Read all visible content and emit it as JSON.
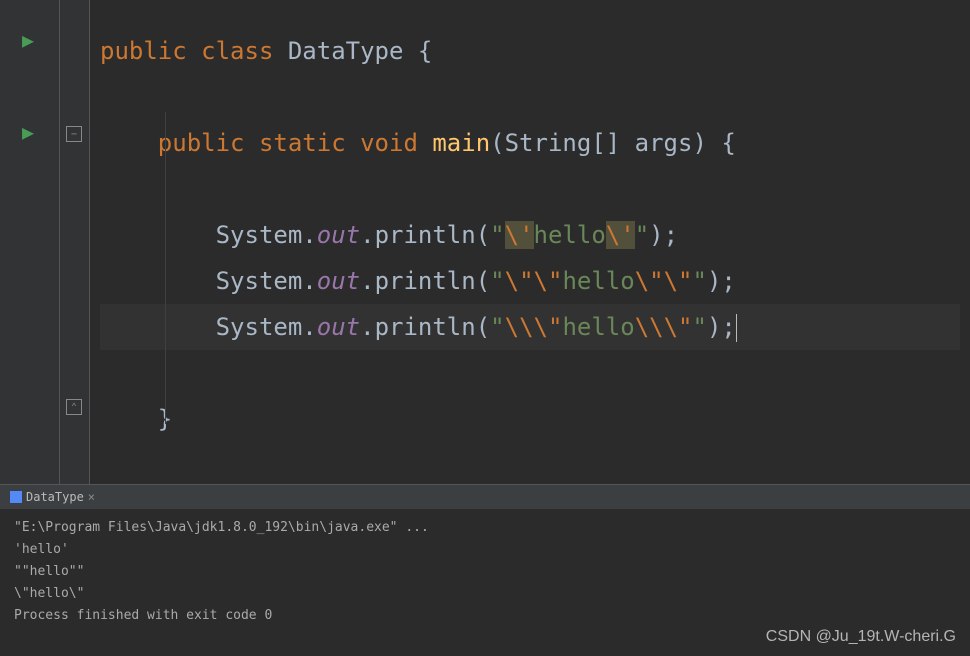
{
  "code": {
    "line1_tokens": [
      "public",
      " ",
      "class",
      " ",
      "DataType",
      " {"
    ],
    "line2_tokens": [
      "    ",
      "public",
      " ",
      "static",
      " ",
      "void",
      " ",
      "main",
      "(",
      "String",
      "[] args) {"
    ],
    "println_call": "System",
    "dot": ".",
    "out_field": "out",
    "println_method": "println",
    "str_quote": "\"",
    "esc_sq": "\\'",
    "hello": "hello",
    "esc_dq": "\\\"",
    "esc_bslash": "\\\\",
    "semicolon": ";",
    "close_brace": "}"
  },
  "console": {
    "tab_name": "DataType",
    "line1": "\"E:\\Program Files\\Java\\jdk1.8.0_192\\bin\\java.exe\" ...",
    "line2": "'hello'",
    "line3": "\"\"hello\"\"",
    "line4": "\\\"hello\\\"",
    "line5": "",
    "line6": "Process finished with exit code 0"
  },
  "watermark": "CSDN @Ju_19t.W-cheri.G"
}
